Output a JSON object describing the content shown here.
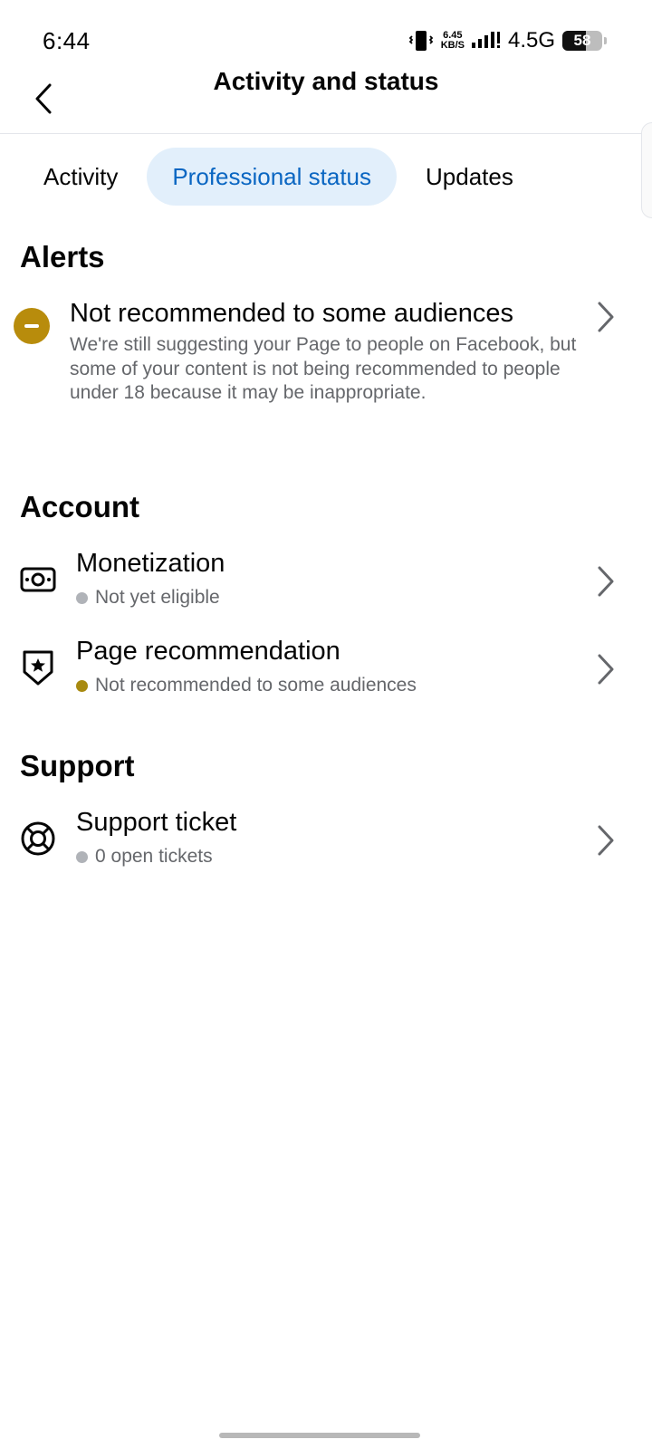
{
  "status_bar": {
    "time": "6:44",
    "net_speed_value": "6.45",
    "net_speed_unit": "KB/S",
    "network_type": "4.5G",
    "battery": "58"
  },
  "header": {
    "title": "Activity and status"
  },
  "tabs": [
    {
      "label": "Activity"
    },
    {
      "label": "Professional status"
    },
    {
      "label": "Updates"
    }
  ],
  "alerts": {
    "heading": "Alerts",
    "items": [
      {
        "title": "Not recommended to some audiences",
        "description": "We're still suggesting your Page to people on Facebook, but some of your content is not being recommended to people under 18 because it may be inappropriate."
      }
    ]
  },
  "account": {
    "heading": "Account",
    "items": [
      {
        "title": "Monetization",
        "status": "Not yet eligible"
      },
      {
        "title": "Page recommendation",
        "status": "Not recommended to some audiences"
      }
    ]
  },
  "support": {
    "heading": "Support",
    "items": [
      {
        "title": "Support ticket",
        "status": "0 open tickets"
      }
    ]
  },
  "colors": {
    "accent_blue": "#0a66c2",
    "tab_active_bg": "#e2effb",
    "warning": "#b88c0c",
    "muted_dot": "#b0b3b8"
  }
}
